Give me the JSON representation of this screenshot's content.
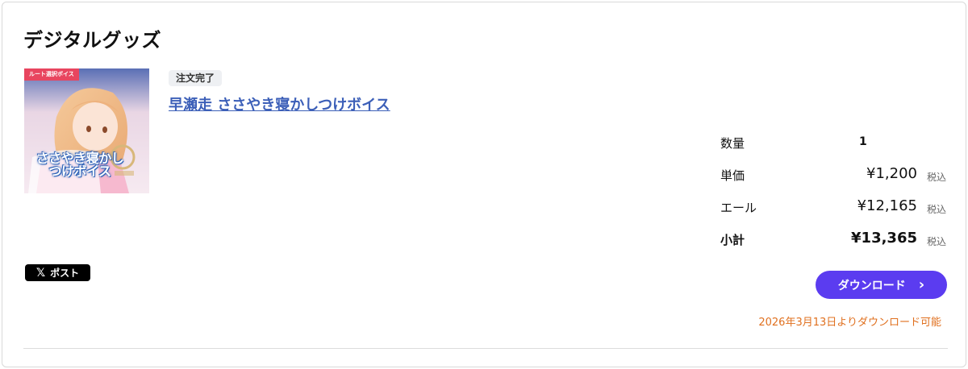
{
  "section": {
    "title": "デジタルグッズ"
  },
  "product": {
    "thumbnail": {
      "tag": "ルート選択ボイス",
      "title": "ささやき寝かしつけボイス",
      "icon": "character-illustration"
    },
    "status": "注文完了",
    "name": "早瀬走 ささやき寝かしつけボイス"
  },
  "prices": {
    "quantity": {
      "label": "数量",
      "value": "1"
    },
    "unit": {
      "label": "単価",
      "value": "¥1,200",
      "tax": "税込"
    },
    "yell": {
      "label": "エール",
      "value": "¥12,165",
      "tax": "税込"
    },
    "subtotal": {
      "label": "小計",
      "value": "¥13,365",
      "tax": "税込"
    }
  },
  "share": {
    "post_label": "ポスト",
    "icon": "x-logo-icon"
  },
  "download": {
    "label": "ダウンロード",
    "note": "2026年3月13日よりダウンロード可能",
    "accent_color": "#5b3cf0",
    "note_color": "#e0701f"
  }
}
